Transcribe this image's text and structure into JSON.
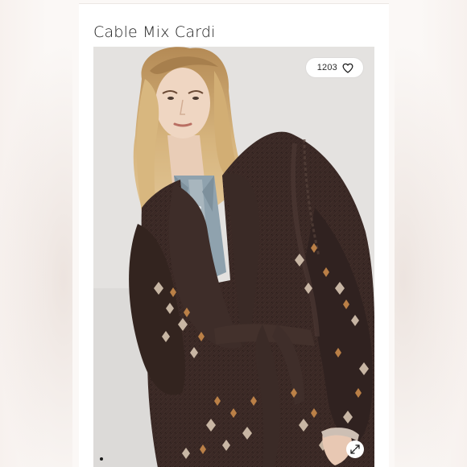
{
  "product": {
    "title": "Cable Mix Cardi"
  },
  "likes": {
    "count": "1203",
    "icon": "heart-outline-icon"
  },
  "gallery": {
    "expand_icon": "expand-arrows-icon",
    "indicator": "carousel-dot"
  },
  "colors": {
    "page_bg": "#fbf8f6",
    "card_bg": "#ffffff",
    "photo_bg": "#e3e1df",
    "cardigan": "#3a2a26",
    "pattern_light": "#d9c7b4",
    "pattern_orange": "#c98a4b",
    "hair": "#c9a56e",
    "text": "#1b1b1b"
  }
}
